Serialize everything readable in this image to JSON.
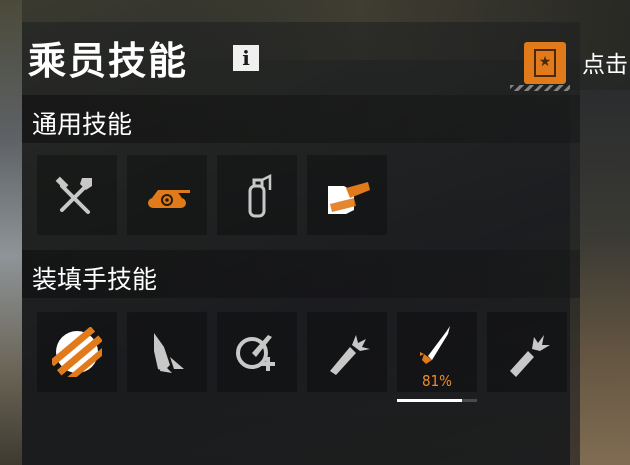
{
  "header": {
    "title": "乘员技能",
    "info_label": "i"
  },
  "hint": {
    "text": "点击"
  },
  "sections": [
    {
      "label": "通用技能",
      "skills": [
        {
          "icon": "repair-tools-icon",
          "active": false
        },
        {
          "icon": "camouflage-tank-icon",
          "active": true
        },
        {
          "icon": "fire-extinguisher-icon",
          "active": false
        },
        {
          "icon": "brothers-in-arms-icon",
          "active": true
        }
      ]
    },
    {
      "label": "装填手技能",
      "skills": [
        {
          "icon": "ammo-rack-icon",
          "active": true
        },
        {
          "icon": "shell-fin-icon",
          "active": false
        },
        {
          "icon": "shell-reload-icon",
          "active": false
        },
        {
          "icon": "shell-burst-icon",
          "active": false
        },
        {
          "icon": "shell-training-icon",
          "active": true,
          "progress_text": "81%",
          "progress": 0.81
        },
        {
          "icon": "shell-break-icon",
          "active": false
        }
      ]
    }
  ],
  "colors": {
    "accent": "#e07a1a",
    "icon_inactive": "#c8c8c8",
    "text": "#ffffff"
  }
}
